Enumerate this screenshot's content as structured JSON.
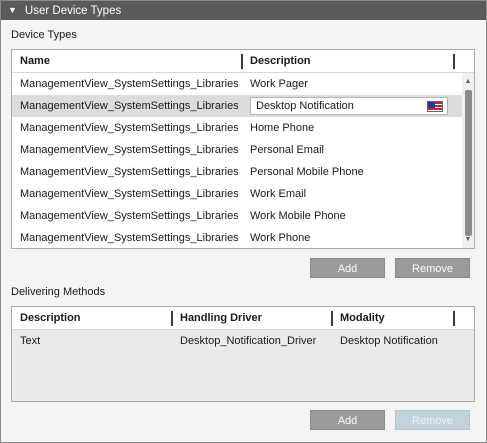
{
  "panel": {
    "title": "User Device Types"
  },
  "device_types": {
    "label": "Device Types",
    "columns": [
      "Name",
      "Description"
    ],
    "rows": [
      {
        "name": "ManagementView_SystemSettings_Libraries_",
        "description": "Work Pager"
      },
      {
        "name": "ManagementView_SystemSettings_Libraries_",
        "description": "Desktop Notification"
      },
      {
        "name": "ManagementView_SystemSettings_Libraries_",
        "description": "Home Phone"
      },
      {
        "name": "ManagementView_SystemSettings_Libraries_",
        "description": "Personal Email"
      },
      {
        "name": "ManagementView_SystemSettings_Libraries_",
        "description": "Personal Mobile Phone"
      },
      {
        "name": "ManagementView_SystemSettings_Libraries_",
        "description": "Work Email"
      },
      {
        "name": "ManagementView_SystemSettings_Libraries_",
        "description": "Work Mobile Phone"
      },
      {
        "name": "ManagementView_SystemSettings_Libraries_",
        "description": "Work Phone"
      }
    ],
    "selected_row_index": 1,
    "editing_value": "Desktop Notification",
    "flag_icon": "us-flag-icon",
    "add_label": "Add",
    "remove_label": "Remove"
  },
  "delivering_methods": {
    "label": "Delivering Methods",
    "columns": [
      "Description",
      "Handling Driver",
      "Modality"
    ],
    "rows": [
      {
        "description": "Text",
        "handling_driver": "Desktop_Notification_Driver",
        "modality": "Desktop Notification"
      }
    ],
    "add_label": "Add",
    "remove_label": "Remove",
    "remove_enabled": false
  },
  "colors": {
    "titlebar": "#5a5a5a",
    "button": "#9a9a9a",
    "button_disabled": "#c3d3dc"
  }
}
